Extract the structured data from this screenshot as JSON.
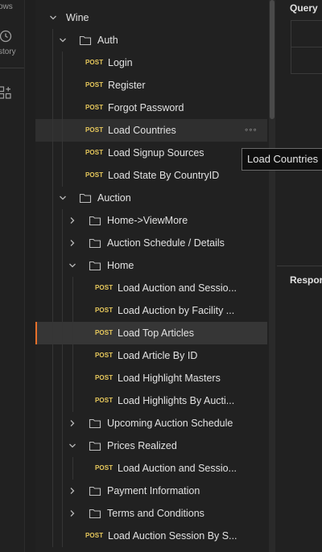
{
  "iconbar": {
    "items": [
      {
        "label": "ows"
      },
      {
        "label": "story"
      }
    ]
  },
  "right_panel": {
    "query_label": "Query",
    "response_label": "Respor"
  },
  "tooltip": {
    "text": "Load Countries"
  },
  "tree": {
    "collection": "Wine",
    "rows": [
      {
        "type": "collection",
        "depth": 0,
        "expanded": true,
        "label": "Wine"
      },
      {
        "type": "folder",
        "depth": 1,
        "expanded": true,
        "label": "Auth"
      },
      {
        "type": "request",
        "depth": 2,
        "method": "POST",
        "label": "Login"
      },
      {
        "type": "request",
        "depth": 2,
        "method": "POST",
        "label": "Register"
      },
      {
        "type": "request",
        "depth": 2,
        "method": "POST",
        "label": "Forgot Password"
      },
      {
        "type": "request",
        "depth": 2,
        "method": "POST",
        "label": "Load Countries",
        "hover": true
      },
      {
        "type": "request",
        "depth": 2,
        "method": "POST",
        "label": "Load Signup Sources"
      },
      {
        "type": "request",
        "depth": 2,
        "method": "POST",
        "label": "Load State By CountryID"
      },
      {
        "type": "folder",
        "depth": 1,
        "expanded": true,
        "label": "Auction"
      },
      {
        "type": "folder",
        "depth": 2,
        "expanded": false,
        "label": "Home->ViewMore"
      },
      {
        "type": "folder",
        "depth": 2,
        "expanded": false,
        "label": "Auction Schedule / Details"
      },
      {
        "type": "folder",
        "depth": 2,
        "expanded": true,
        "label": "Home"
      },
      {
        "type": "request",
        "depth": 3,
        "method": "POST",
        "label": "Load Auction and Sessio..."
      },
      {
        "type": "request",
        "depth": 3,
        "method": "POST",
        "label": "Load Auction by Facility ..."
      },
      {
        "type": "request",
        "depth": 3,
        "method": "POST",
        "label": "Load Top Articles",
        "active": true
      },
      {
        "type": "request",
        "depth": 3,
        "method": "POST",
        "label": "Load Article By ID"
      },
      {
        "type": "request",
        "depth": 3,
        "method": "POST",
        "label": "Load Highlight Masters"
      },
      {
        "type": "request",
        "depth": 3,
        "method": "POST",
        "label": "Load Highlights By Aucti..."
      },
      {
        "type": "folder",
        "depth": 2,
        "expanded": false,
        "label": "Upcoming Auction Schedule"
      },
      {
        "type": "folder",
        "depth": 2,
        "expanded": true,
        "label": "Prices Realized"
      },
      {
        "type": "request",
        "depth": 3,
        "method": "POST",
        "label": "Load Auction and Sessio..."
      },
      {
        "type": "folder",
        "depth": 2,
        "expanded": false,
        "label": "Payment Information"
      },
      {
        "type": "folder",
        "depth": 2,
        "expanded": false,
        "label": "Terms and Conditions"
      },
      {
        "type": "request",
        "depth": 2,
        "method": "POST",
        "label": "Load Auction Session By S..."
      }
    ]
  },
  "colors": {
    "background": "#212121",
    "method_post": "#e8c95c",
    "active_accent": "#e8702a"
  }
}
